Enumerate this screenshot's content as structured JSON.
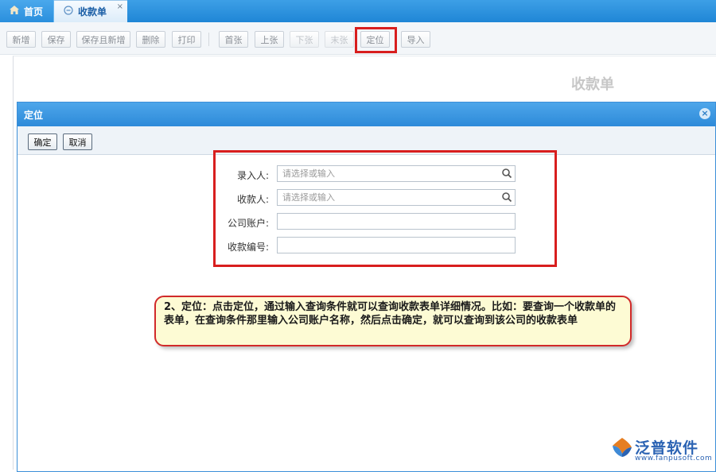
{
  "tabs": {
    "home_label": "首页",
    "active_label": "收款单",
    "close_glyph": "×"
  },
  "toolbar": {
    "buttons": [
      {
        "label": "新增",
        "enabled": true
      },
      {
        "label": "保存",
        "enabled": true
      },
      {
        "label": "保存且新增",
        "enabled": true
      },
      {
        "label": "删除",
        "enabled": true
      },
      {
        "label": "打印",
        "enabled": true
      },
      {
        "label": "首张",
        "enabled": true
      },
      {
        "label": "上张",
        "enabled": true
      },
      {
        "label": "下张",
        "enabled": false
      },
      {
        "label": "末张",
        "enabled": false
      },
      {
        "label": "定位",
        "enabled": true
      },
      {
        "label": "导入",
        "enabled": true
      }
    ]
  },
  "form": {
    "title": "收款单"
  },
  "dialog": {
    "title": "定位",
    "confirm_label": "确定",
    "cancel_label": "取消",
    "fields": [
      {
        "label": "录入人:",
        "placeholder": "请选择或输入",
        "has_search": true
      },
      {
        "label": "收款人:",
        "placeholder": "请选择或输入",
        "has_search": true
      },
      {
        "label": "公司账户:",
        "placeholder": "",
        "has_search": false
      },
      {
        "label": "收款编号:",
        "placeholder": "",
        "has_search": false
      }
    ]
  },
  "callout": {
    "text": "2、定位：点击定位，通过输入查询条件就可以查询收款表单详细情况。比如：要查询一个收款单的表单，在查询条件那里输入公司账户名称，然后点击确定，就可以查询到该公司的收款表单"
  },
  "watermark": {
    "name": "泛普软件",
    "url": "www.fanpusoft.com"
  },
  "colors": {
    "tab_bar": "#2a8fdd",
    "dialog_header": "#3d97e0",
    "highlight_border": "#d81e1e",
    "callout_bg": "#fdfbd4",
    "logo": "#2b63b3"
  }
}
